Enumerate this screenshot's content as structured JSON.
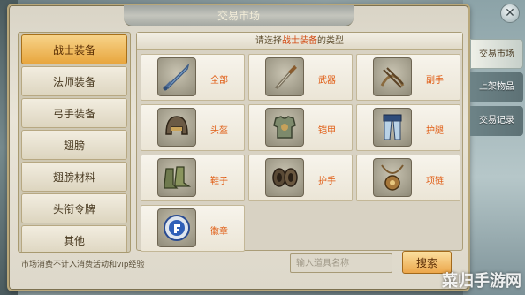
{
  "window": {
    "title": "交易市场"
  },
  "categories": [
    {
      "label": "战士装备",
      "active": true
    },
    {
      "label": "法师装备",
      "active": false
    },
    {
      "label": "弓手装备",
      "active": false
    },
    {
      "label": "翅膀",
      "active": false
    },
    {
      "label": "翅膀材料",
      "active": false
    },
    {
      "label": "头衔令牌",
      "active": false
    },
    {
      "label": "其他",
      "active": false
    }
  ],
  "main": {
    "header_prefix": "请选择",
    "header_highlight": "战士装备",
    "header_suffix": "的类型",
    "items": [
      {
        "label": "全部",
        "icon": "sword-icon"
      },
      {
        "label": "武器",
        "icon": "weapon-icon"
      },
      {
        "label": "副手",
        "icon": "offhand-icon"
      },
      {
        "label": "头盔",
        "icon": "helmet-icon"
      },
      {
        "label": "铠甲",
        "icon": "armor-icon"
      },
      {
        "label": "护腿",
        "icon": "legguard-icon"
      },
      {
        "label": "鞋子",
        "icon": "boots-icon"
      },
      {
        "label": "护手",
        "icon": "gauntlet-icon"
      },
      {
        "label": "项链",
        "icon": "necklace-icon"
      },
      {
        "label": "徽章",
        "icon": "badge-icon"
      }
    ]
  },
  "footer": {
    "note": "市场消费不计入消费活动和vip经验",
    "search_placeholder": "输入道具名称",
    "search_label": "搜索"
  },
  "right_tabs": [
    {
      "label": "交易市场",
      "active": true
    },
    {
      "label": "上架物品",
      "active": false
    },
    {
      "label": "交易记录",
      "active": false
    }
  ],
  "watermark": "菜归手游网",
  "colors": {
    "accent": "#e8a63e",
    "highlight_text": "#e05a10"
  }
}
